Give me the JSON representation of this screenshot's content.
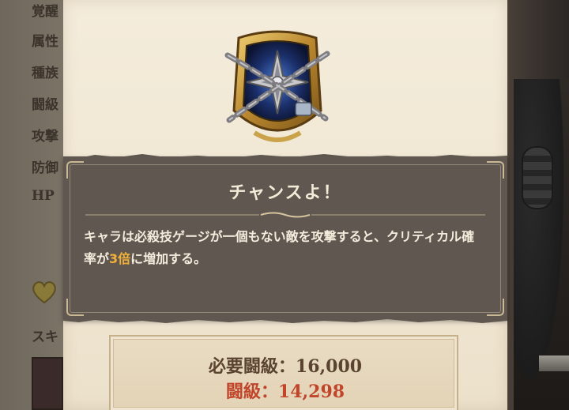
{
  "background_labels": [
    "覚醒",
    "属性",
    "種族",
    "闘級",
    "攻撃",
    "防御",
    "HP",
    "スキ"
  ],
  "popup": {
    "title": "チャンスよ！",
    "description_before": "キャラは必殺技ゲージが一個もない敵を攻撃すると、クリティカル確率が",
    "description_highlight": "3倍",
    "description_after": "に増加する。"
  },
  "requirement": {
    "required_label": "必要闘級",
    "required_value": "16,000",
    "current_label": "闘級",
    "current_value": "14,298",
    "separator": "："
  },
  "skill_icon": {
    "name": "chained-compass-emblem-icon"
  },
  "colors": {
    "highlight": "#f0b03a",
    "current_value": "#c0452a",
    "required_value": "#5a4330",
    "popup_bg": "#605850"
  }
}
